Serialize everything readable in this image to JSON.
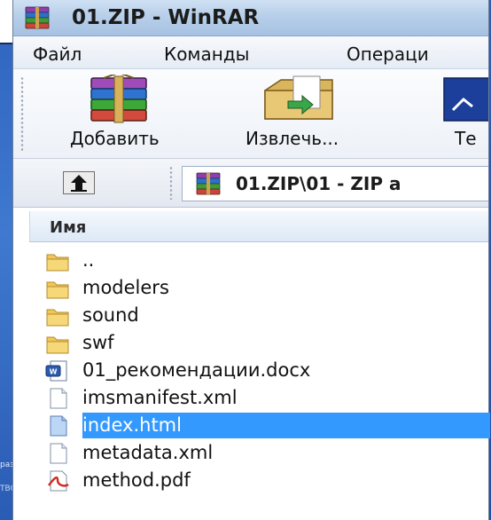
{
  "background": {
    "left_text_1": "раз",
    "left_text_2": "ТВС"
  },
  "window": {
    "title": "01.ZIP - WinRAR"
  },
  "menu": {
    "items": [
      "Файл",
      "Команды",
      "Операци"
    ]
  },
  "toolbar": {
    "buttons": [
      {
        "label": "Добавить",
        "icon": "add-archive-icon"
      },
      {
        "label": "Извлечь...",
        "icon": "extract-icon"
      },
      {
        "label": "Те",
        "icon": "test-icon"
      }
    ]
  },
  "address": {
    "up_icon": "up-arrow-icon",
    "path": "01.ZIP\\01 - ZIP a"
  },
  "filelist": {
    "header": "Имя",
    "rows": [
      {
        "name": "..",
        "icon": "folder-icon",
        "selected": false
      },
      {
        "name": "modelers",
        "icon": "folder-icon",
        "selected": false
      },
      {
        "name": "sound",
        "icon": "folder-icon",
        "selected": false
      },
      {
        "name": "swf",
        "icon": "folder-icon",
        "selected": false
      },
      {
        "name": "01_рекомендации.docx",
        "icon": "word-document-icon",
        "selected": false
      },
      {
        "name": "imsmanifest.xml",
        "icon": "file-icon",
        "selected": false
      },
      {
        "name": "index.html",
        "icon": "html-file-icon",
        "selected": true
      },
      {
        "name": "metadata.xml",
        "icon": "file-icon",
        "selected": false
      },
      {
        "name": "method.pdf",
        "icon": "pdf-icon",
        "selected": false
      }
    ]
  },
  "colors": {
    "selection": "#3399ff",
    "title_bar": "#b7cfe9",
    "background_blue": "#3a6fc4"
  }
}
